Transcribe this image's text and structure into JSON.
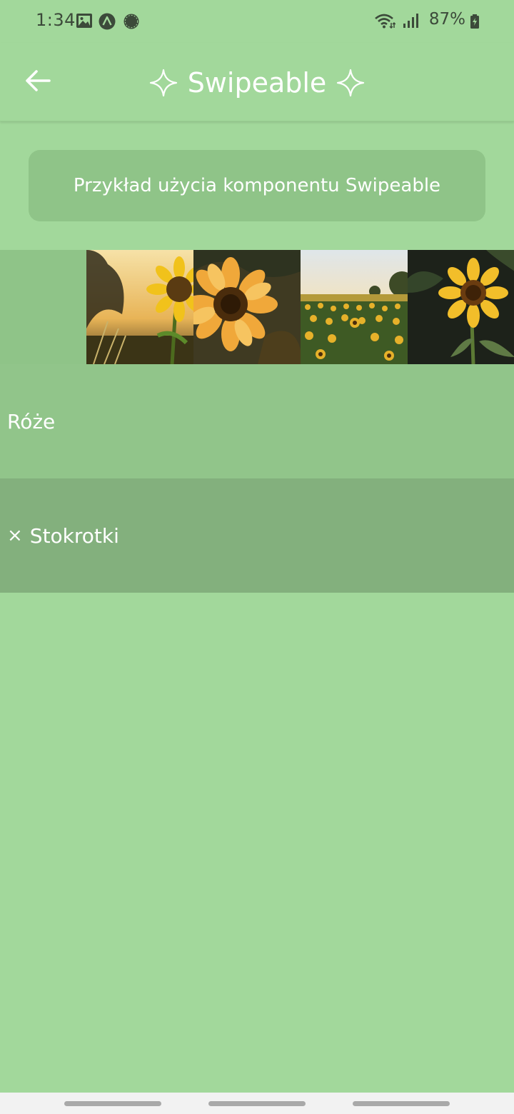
{
  "status_bar": {
    "time": "1:34",
    "battery_percent": "87%",
    "left_icons": [
      "gallery-icon",
      "app-a-icon",
      "chat-icon"
    ],
    "right_icons": [
      "wifi-icon",
      "signal-icon",
      "battery-charging-icon"
    ]
  },
  "app_bar": {
    "title": "Swipeable",
    "back_icon": "arrow-left-icon",
    "decor_icon": "sparkle-icon"
  },
  "banner": {
    "text": "Przykład użycia komponentu Swipeable"
  },
  "swipe_row": {
    "photos": [
      {
        "name": "sunflower-sunset-photo"
      },
      {
        "name": "sunflower-closeup-photo"
      },
      {
        "name": "sunflower-field-photo"
      },
      {
        "name": "sunflower-dark-photo"
      }
    ]
  },
  "list": {
    "items": [
      {
        "label": "Róże",
        "removable": false
      },
      {
        "label": "Stokrotki",
        "removable": true,
        "remove_glyph": "×"
      }
    ]
  },
  "colors": {
    "background": "#a2d89b",
    "banner": "#8fc488",
    "item_roze": "#91c58a",
    "item_stokrotki": "#83b07d",
    "text": "#ffffff"
  }
}
